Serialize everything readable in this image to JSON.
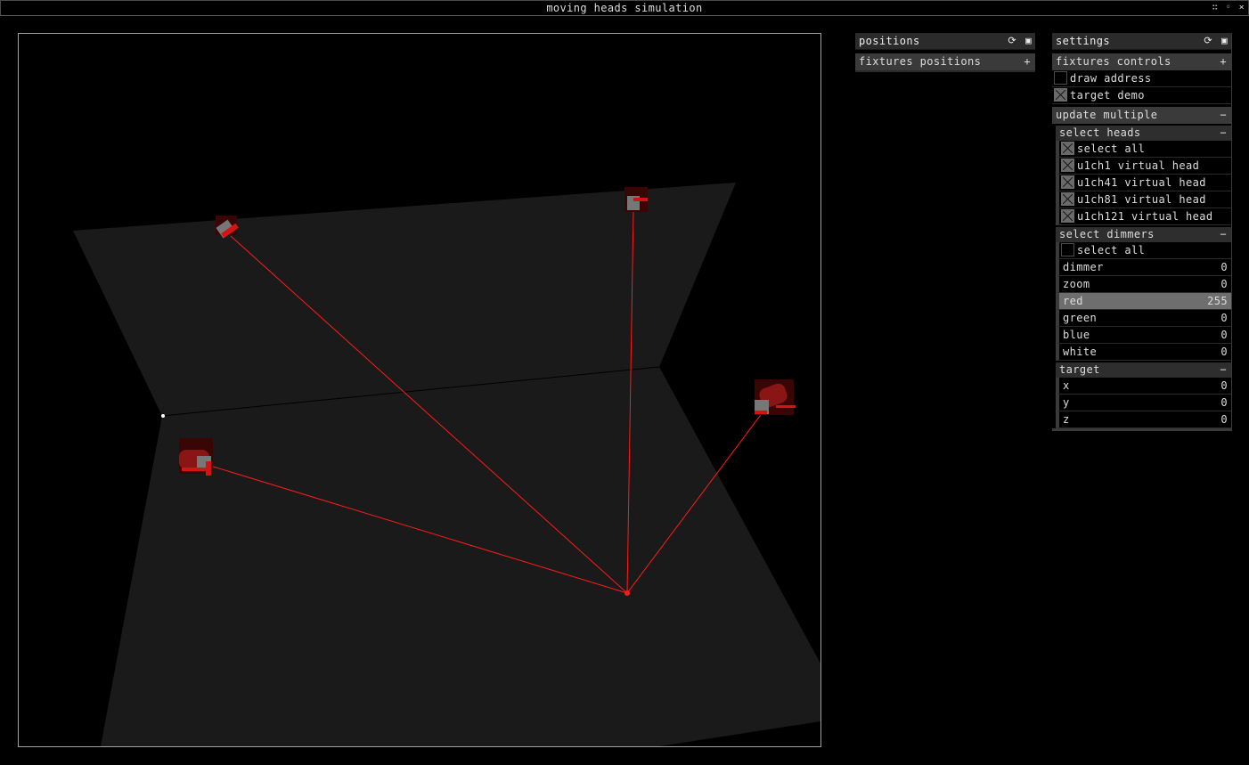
{
  "window": {
    "title": "moving heads simulation",
    "controls": [
      "∷",
      "◦",
      "×"
    ]
  },
  "positions_panel": {
    "title": "positions",
    "icons": {
      "reload": "⟳",
      "save": "▣"
    },
    "group": {
      "label": "fixtures positions",
      "toggle": "+"
    }
  },
  "settings_panel": {
    "title": "settings",
    "icons": {
      "reload": "⟳",
      "save": "▣"
    },
    "fixtures_controls": {
      "label": "fixtures controls",
      "toggle": "+"
    },
    "toggles": [
      {
        "label": "draw address",
        "checked": false
      },
      {
        "label": "target demo",
        "checked": true
      }
    ],
    "update_multiple": {
      "label": "update multiple",
      "toggle": "−",
      "select_heads": {
        "label": "select heads",
        "toggle": "−",
        "items": [
          {
            "label": "select all",
            "checked": true
          },
          {
            "label": "u1ch1 virtual head",
            "checked": true
          },
          {
            "label": "u1ch41 virtual head",
            "checked": true
          },
          {
            "label": "u1ch81 virtual head",
            "checked": true
          },
          {
            "label": "u1ch121 virtual head",
            "checked": true
          }
        ]
      },
      "select_dimmers": {
        "label": "select dimmers",
        "toggle": "−",
        "select_all": {
          "label": "select all",
          "checked": false
        },
        "sliders": [
          {
            "label": "dimmer",
            "value": "0"
          },
          {
            "label": "zoom",
            "value": "0"
          },
          {
            "label": "red",
            "value": "255"
          },
          {
            "label": "green",
            "value": "0"
          },
          {
            "label": "blue",
            "value": "0"
          },
          {
            "label": "white",
            "value": "0"
          }
        ]
      },
      "target": {
        "label": "target",
        "toggle": "−",
        "fields": [
          {
            "label": "x",
            "value": "0"
          },
          {
            "label": "y",
            "value": "0"
          },
          {
            "label": "z",
            "value": "0"
          }
        ]
      }
    }
  },
  "colors": {
    "beam": "#ff1a1a",
    "floor": "#1a1a1a",
    "fixture": "#6a0a0a"
  }
}
